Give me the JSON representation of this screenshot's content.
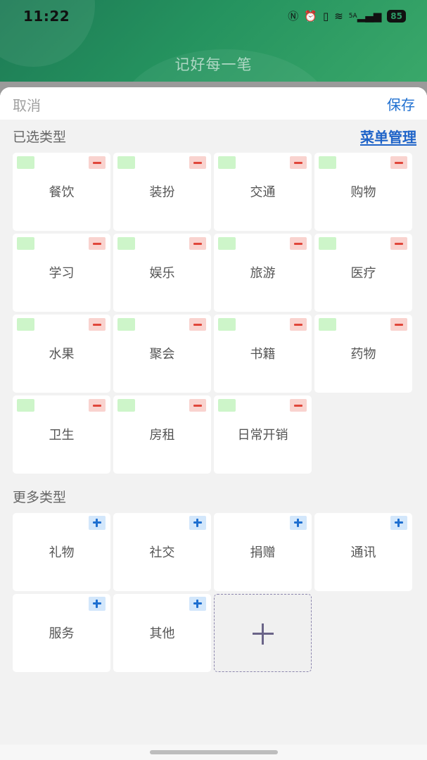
{
  "status_bar": {
    "time": "11:22",
    "icons": [
      "nfc-icon",
      "alarm-icon",
      "vibrate-icon",
      "wifi-icon",
      "signal-5g-icon"
    ],
    "signal_label": "5A",
    "battery": "85"
  },
  "header": {
    "title": "记好每一笔"
  },
  "sheet": {
    "cancel_label": "取消",
    "save_label": "保存",
    "selected_section_label": "已选类型",
    "menu_manage_label": "菜单管理",
    "more_section_label": "更多类型"
  },
  "selected_types": [
    "餐饮",
    "装扮",
    "交通",
    "购物",
    "学习",
    "娱乐",
    "旅游",
    "医疗",
    "水果",
    "聚会",
    "书籍",
    "药物",
    "卫生",
    "房租",
    "日常开销"
  ],
  "more_types": [
    "礼物",
    "社交",
    "捐赠",
    "通讯",
    "服务",
    "其他"
  ],
  "colors": {
    "header_green": "#25935f",
    "accent_blue": "#1e6fd0",
    "remove_red": "#e0463a",
    "swatch_green": "#cdf5c9"
  }
}
